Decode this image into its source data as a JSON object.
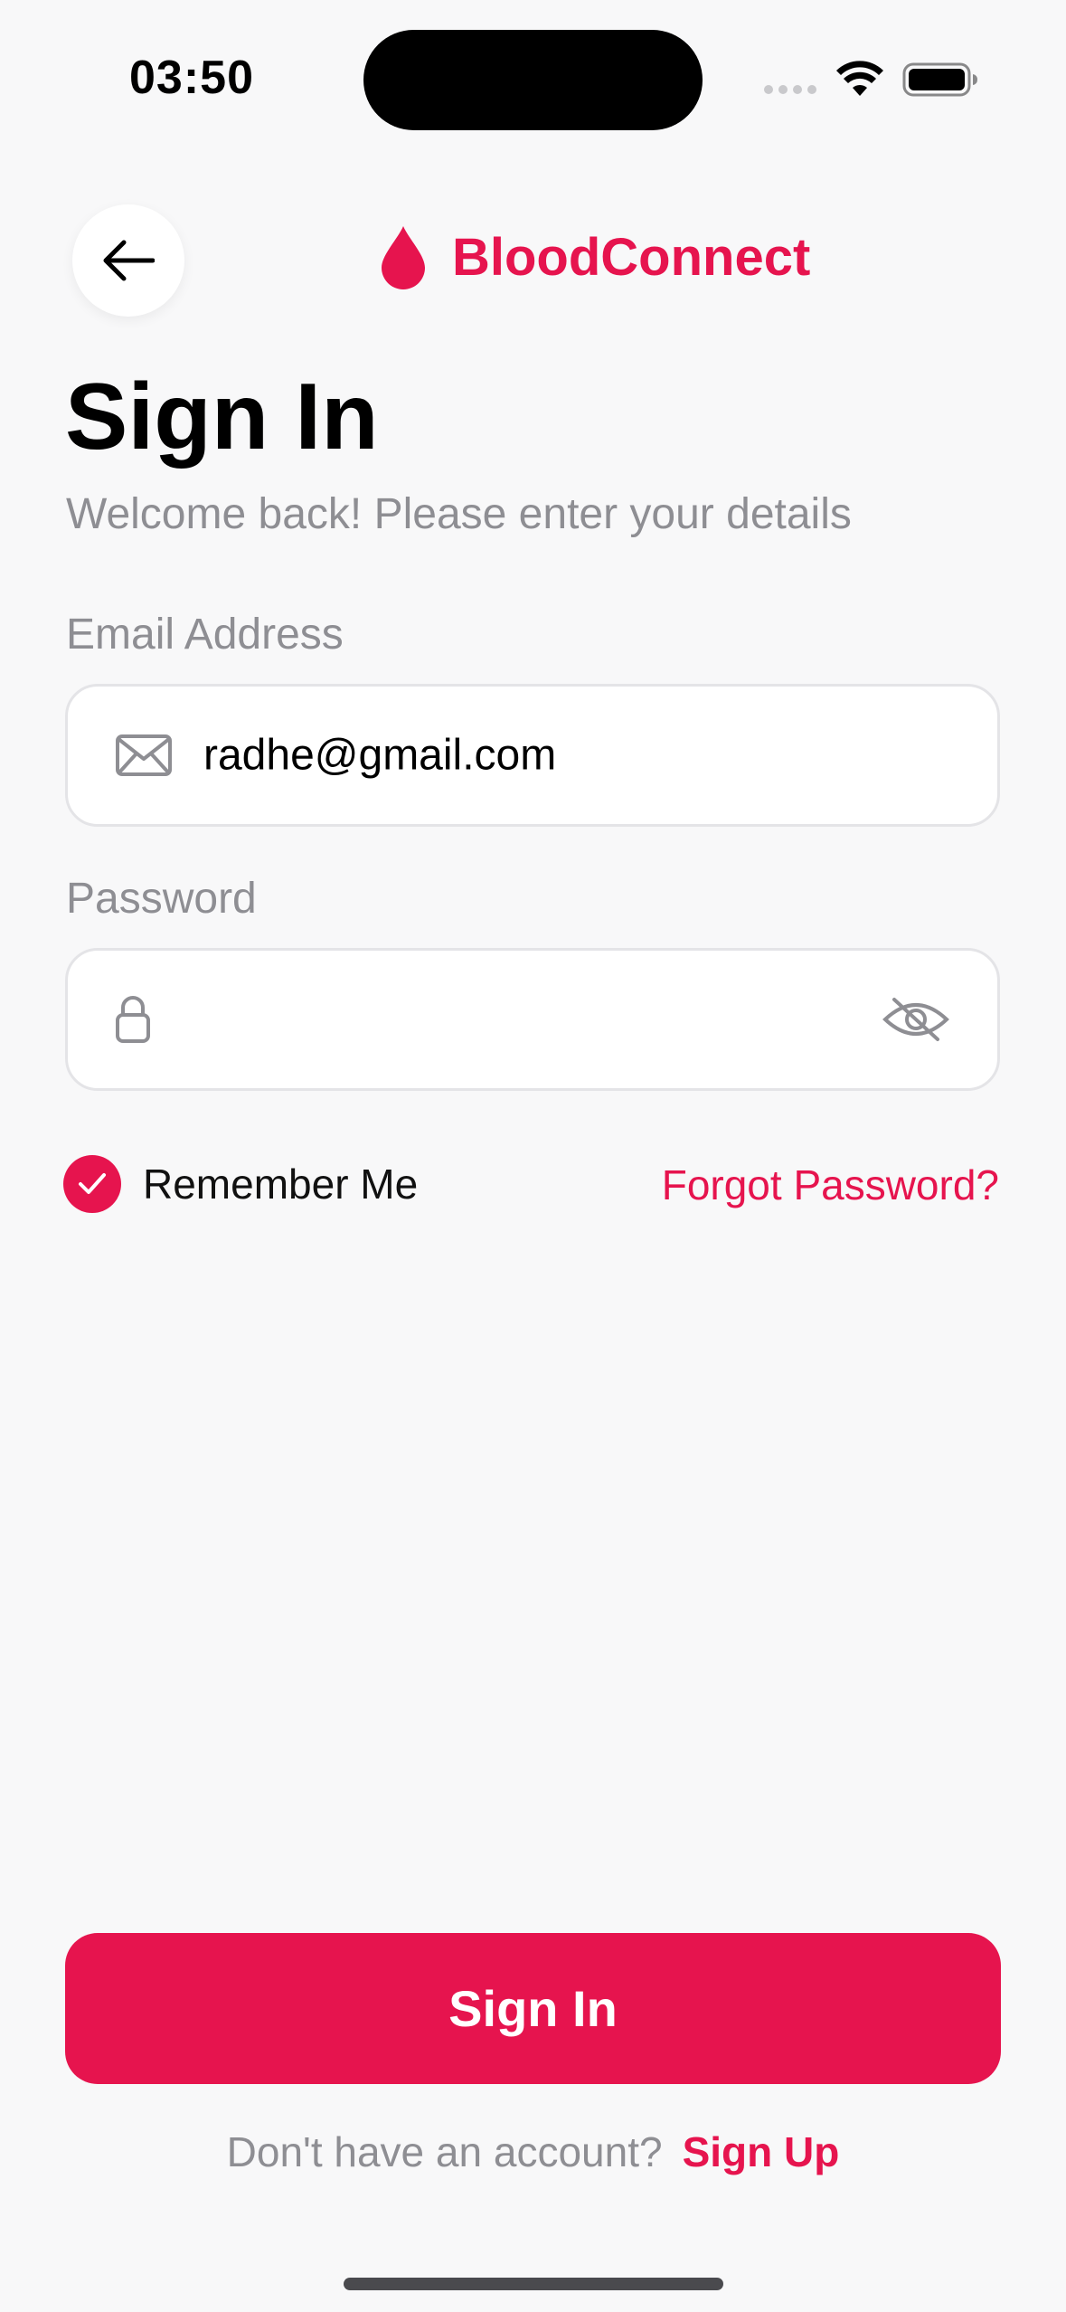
{
  "status_bar": {
    "time": "03:50",
    "icons": [
      "signal-dots-icon",
      "wifi-icon",
      "battery-icon"
    ]
  },
  "header": {
    "back_icon": "arrow-left-icon",
    "brand_icon": "blood-drop-icon",
    "brand_name": "BloodConnect"
  },
  "page": {
    "title": "Sign In",
    "subtitle": "Welcome back! Please enter your details"
  },
  "form": {
    "email": {
      "label": "Email Address",
      "value": "radhe@gmail.com",
      "icon": "mail-icon"
    },
    "password": {
      "label": "Password",
      "value": "",
      "icon": "lock-icon",
      "toggle_icon": "eye-off-icon"
    },
    "remember_me": {
      "label": "Remember Me",
      "checked": true
    },
    "forgot_password": "Forgot Password?"
  },
  "actions": {
    "sign_in_label": "Sign In",
    "signup_prompt": "Don't have an account?",
    "signup_link": "Sign Up"
  },
  "colors": {
    "accent": "#e6144e",
    "background": "#f8f8f9",
    "muted_text": "#8e8e93"
  }
}
